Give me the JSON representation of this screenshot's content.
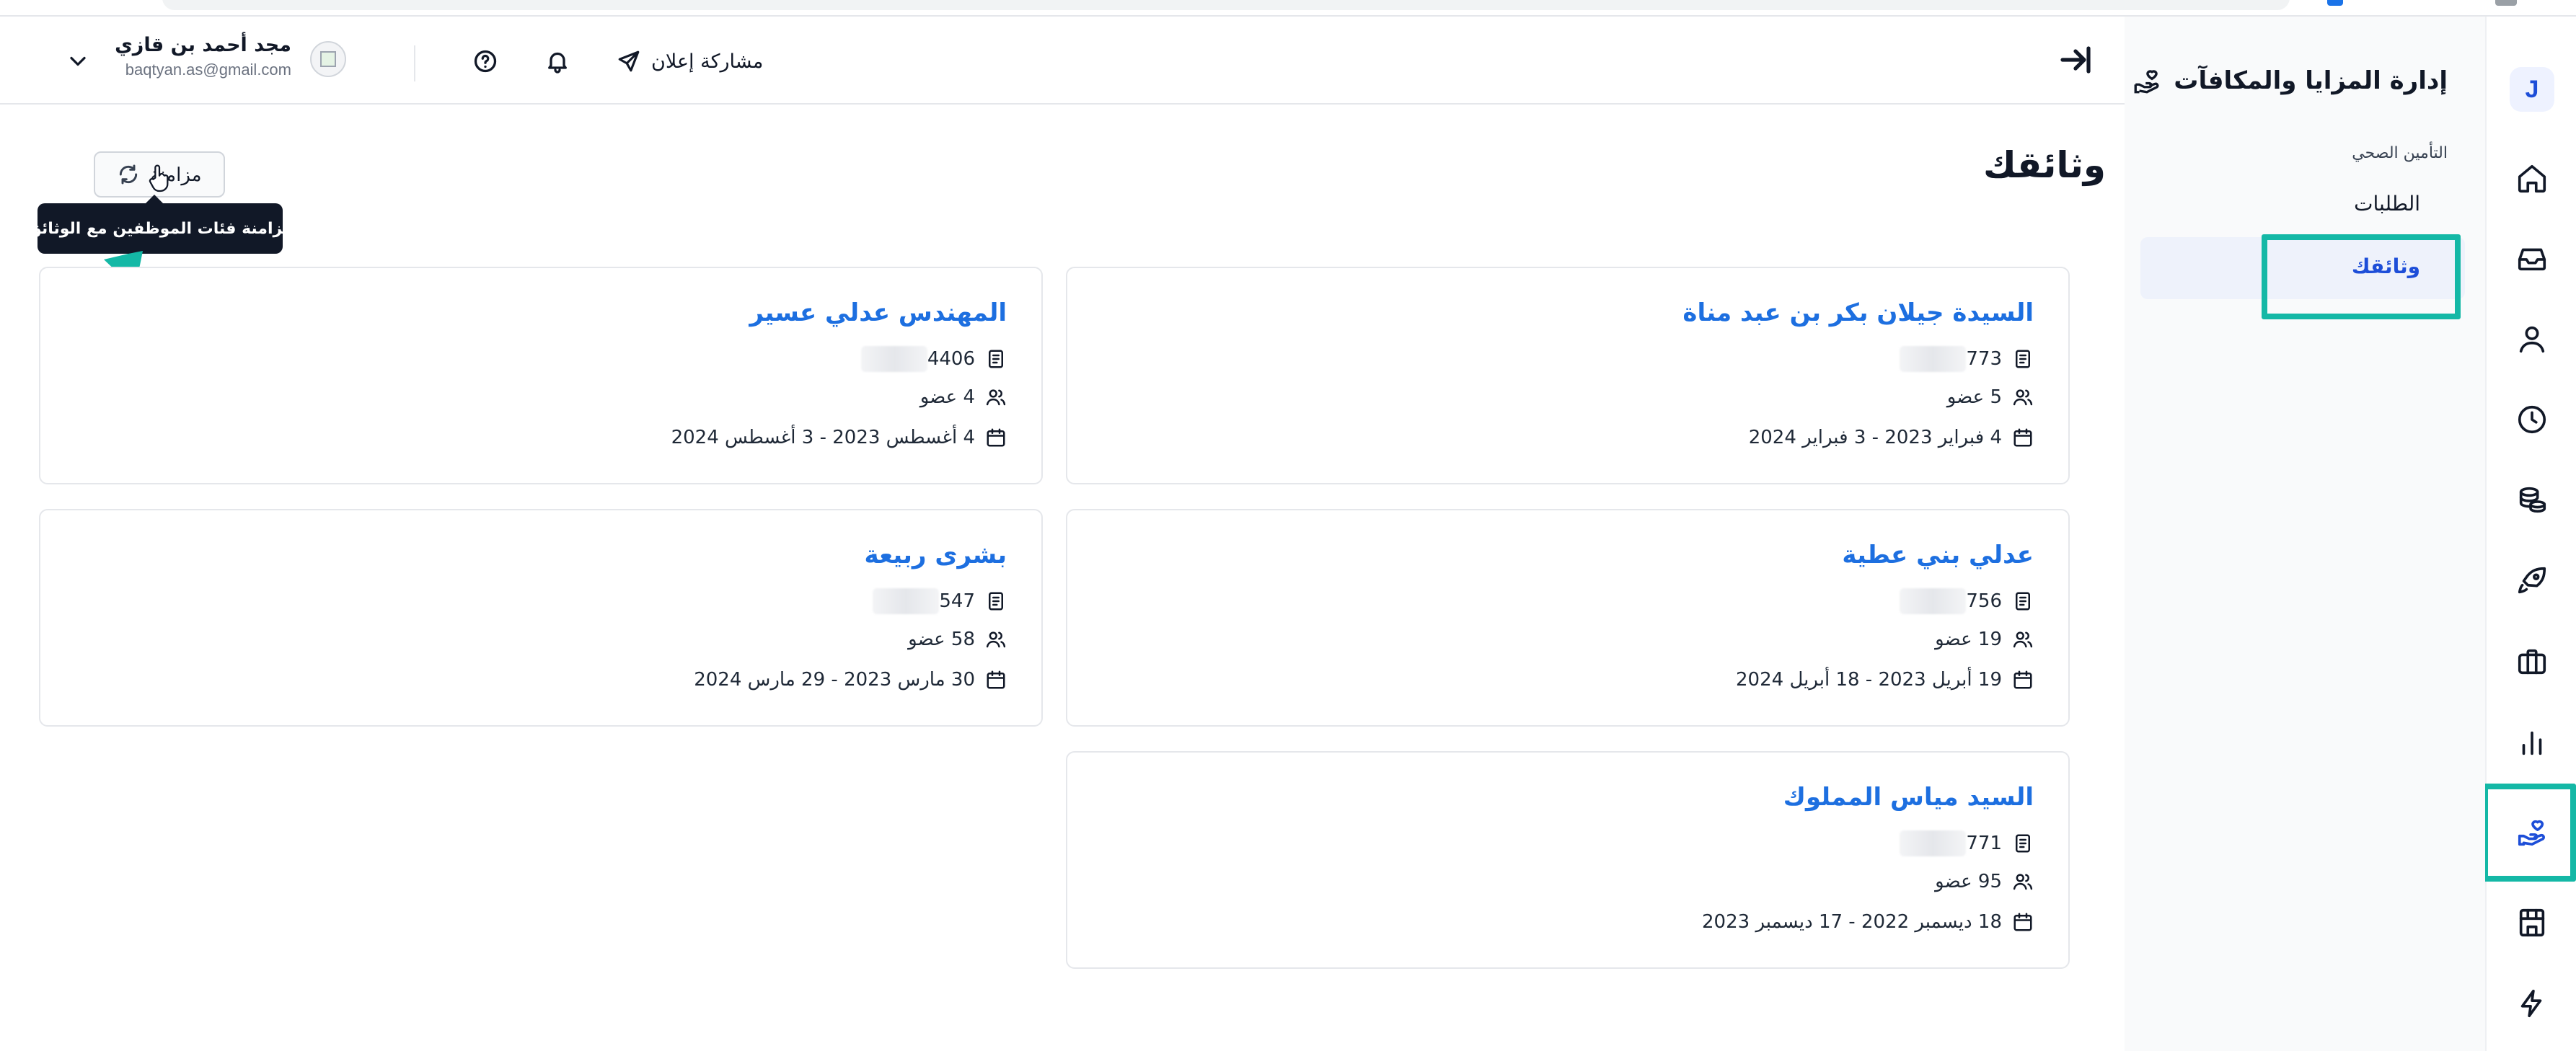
{
  "sidebar": {
    "logo_letter": "J",
    "module_title": "إدارة المزايا والمكافآت",
    "section_label": "التأمين الصحي",
    "items": [
      {
        "label": "الطلبات",
        "active": false
      },
      {
        "label": "وثائقك",
        "active": true
      }
    ],
    "rail_icons": [
      "home-icon",
      "inbox-icon",
      "user-icon",
      "clock-icon",
      "coins-icon",
      "rocket-icon",
      "briefcase-icon",
      "chart-icon",
      "benefits-hand-icon",
      "store-icon",
      "bolt-icon"
    ],
    "active_rail_icon": "benefits-hand-icon"
  },
  "header": {
    "share_label": "مشاركة إعلان",
    "user": {
      "name": "مجد أحمد بن قازي",
      "email": "baqtyan.as@gmail.com"
    }
  },
  "main": {
    "title": "وثائقك",
    "sync_button_label": "مزامنة",
    "sync_tooltip": "مزامنة فئات الموظفين مع الوثائق",
    "cards": [
      {
        "name": "السيدة جيلان بكر بن عبد مناة",
        "policy_suffix": "773",
        "members": "5 عضو",
        "dates": "4 فبراير 2023 - 3 فبراير 2024"
      },
      {
        "name": "المهندس عدلي عسير",
        "policy_suffix": "4406",
        "members": "4 عضو",
        "dates": "4 أغسطس 2023 - 3 أغسطس 2024"
      },
      {
        "name": "عدلي بني عطية",
        "policy_suffix": "756",
        "members": "19 عضو",
        "dates": "19 أبريل 2023 - 18 أبريل 2024"
      },
      {
        "name": "بشرى ربيعة",
        "policy_suffix": "547",
        "members": "58 عضو",
        "dates": "30 مارس 2023 - 29 مارس 2024"
      },
      {
        "name": "السيد مياس المملوك",
        "policy_suffix": "771",
        "members": "95 عضو",
        "dates": "18 ديسمبر 2022 - 17 ديسمبر 2023"
      }
    ]
  },
  "colors": {
    "accent": "#1d4ed8",
    "card_title": "#1d6fe0",
    "annotation": "#14b8a6",
    "tooltip_bg": "#111827"
  }
}
